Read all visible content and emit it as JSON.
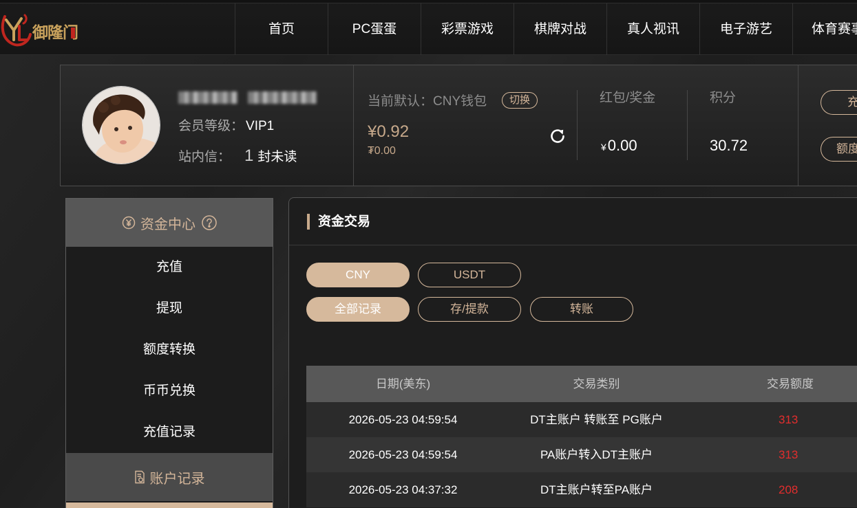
{
  "header": {
    "logo_text": "御隆门",
    "nav": [
      "首页",
      "PC蛋蛋",
      "彩票游戏",
      "棋牌对战",
      "真人视讯",
      "电子游艺",
      "体育赛事"
    ]
  },
  "profile": {
    "member_level_label": "会员等级：",
    "member_level": "VIP1",
    "messages_label": "站内信：",
    "unread_count": "1",
    "unread_suffix": "封未读"
  },
  "wallet": {
    "default_label": "当前默认：CNY钱包",
    "switch_label": "切换",
    "cny_balance": "¥0.92",
    "usdt_balance": "₮0.00",
    "refresh_icon": "refresh-icon"
  },
  "bonus": {
    "label": "红包/奖金",
    "currency": "¥",
    "value": "0.00"
  },
  "points": {
    "label": "积分",
    "value": "30.72"
  },
  "actions": {
    "recharge_label": "充",
    "transfer_label": "额度"
  },
  "sidebar": {
    "sections": [
      {
        "title": "资金中心",
        "icon": "yen-circle-icon",
        "help_icon": "help-circle-icon",
        "items": [
          "充值",
          "提现",
          "额度转换",
          "币币兑换",
          "充值记录"
        ]
      },
      {
        "title": "账户记录",
        "icon": "document-icon"
      }
    ]
  },
  "main": {
    "title": "资金交易",
    "currency_tabs": [
      {
        "label": "CNY",
        "active": true
      },
      {
        "label": "USDT",
        "active": false
      }
    ],
    "record_tabs": [
      {
        "label": "全部记录",
        "active": true
      },
      {
        "label": "存/提款",
        "active": false
      },
      {
        "label": "转账",
        "active": false
      }
    ],
    "table": {
      "columns": [
        "日期(美东)",
        "交易类别",
        "交易额度"
      ],
      "rows": [
        {
          "date": "2026-05-23 04:59:54",
          "type": "DT主账户 转账至 PG账户",
          "amount": "313"
        },
        {
          "date": "2026-05-23 04:59:54",
          "type": "PA账户转入DT主账户",
          "amount": "313"
        },
        {
          "date": "2026-05-23 04:37:32",
          "type": "DT主账户转至PA账户",
          "amount": "208"
        }
      ]
    }
  },
  "colors": {
    "accent": "#d6b99c",
    "accent_text": "#d4b69a",
    "balance": "#c7a98b",
    "amount": "#e22d2d",
    "brand_red": "#c0261f",
    "brand_gold": "#c9a25c"
  }
}
